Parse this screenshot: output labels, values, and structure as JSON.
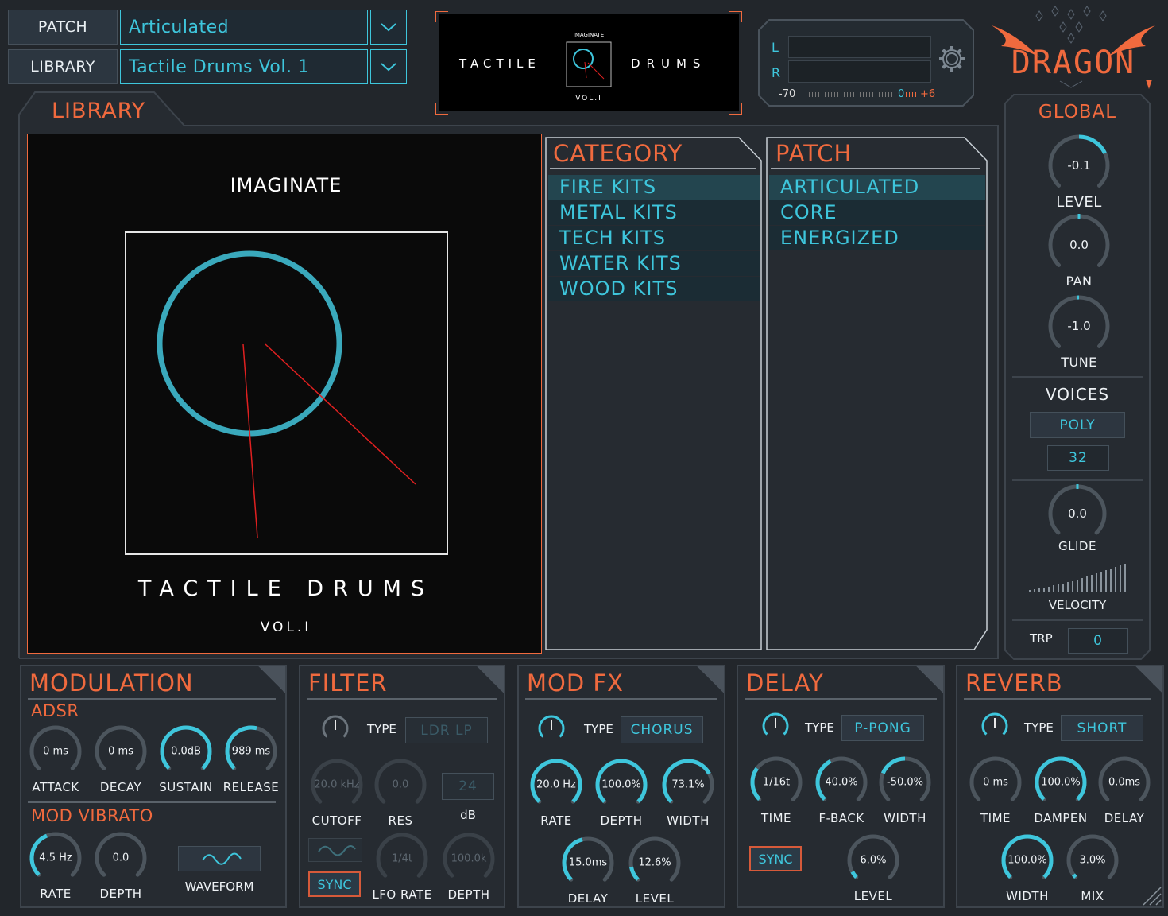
{
  "header": {
    "patch_label": "PATCH",
    "patch_value": "Articulated",
    "library_label": "LIBRARY",
    "library_value": "Tactile Drums Vol. 1",
    "artwork_brand": "IMAGINATE",
    "artwork_left": "TACTILE",
    "artwork_right": "DRUMS",
    "artwork_vol": "VOL.I"
  },
  "meter": {
    "l_label": "L",
    "r_label": "R",
    "min_label": "-70",
    "zero_label": "0",
    "max_label": "+6",
    "level_l": 0.0,
    "level_r": 0.0
  },
  "logo": {
    "text": "DRAGON"
  },
  "library": {
    "tab_label": "LIBRARY",
    "artwork_brand": "IMAGINATE",
    "artwork_title": "TACTILE DRUMS",
    "artwork_vol": "VOL.I",
    "category_header": "CATEGORY",
    "patch_header": "PATCH",
    "categories": [
      "FIRE KITS",
      "METAL KITS",
      "TECH KITS",
      "WATER KITS",
      "WOOD KITS"
    ],
    "patches": [
      "ARTICULATED",
      "CORE",
      "ENERGIZED"
    ]
  },
  "global": {
    "title": "GLOBAL",
    "level": {
      "label": "LEVEL",
      "value": "-0.1"
    },
    "pan": {
      "label": "PAN",
      "value": "0.0"
    },
    "tune": {
      "label": "TUNE",
      "value": "-1.0"
    },
    "voices_title": "VOICES",
    "voices_mode": "POLY",
    "voices_count": "32",
    "glide": {
      "label": "GLIDE",
      "value": "0.0"
    },
    "velocity_label": "VELOCITY",
    "trp_label": "TRP",
    "trp_value": "0"
  },
  "modulation": {
    "title": "MODULATION",
    "adsr_title": "ADSR",
    "attack": {
      "label": "ATTACK",
      "value": "0 ms"
    },
    "decay": {
      "label": "DECAY",
      "value": "0 ms"
    },
    "sustain": {
      "label": "SUSTAIN",
      "value": "0.0dB"
    },
    "release": {
      "label": "RELEASE",
      "value": "989 ms"
    },
    "vibrato_title": "MOD VIBRATO",
    "rate": {
      "label": "RATE",
      "value": "4.5 Hz"
    },
    "depth": {
      "label": "DEPTH",
      "value": "0.0"
    },
    "waveform_label": "WAVEFORM"
  },
  "filter": {
    "title": "FILTER",
    "type_label": "TYPE",
    "type_value": "LDR LP",
    "cutoff": {
      "label": "CUTOFF",
      "value": "20.0 kHz"
    },
    "res": {
      "label": "RES",
      "value": "0.0"
    },
    "db_value": "24",
    "db_label": "dB",
    "sync_label": "SYNC",
    "lfo_rate": {
      "label": "LFO RATE",
      "value": "1/4t"
    },
    "depth": {
      "label": "DEPTH",
      "value": "100.0k"
    }
  },
  "modfx": {
    "title": "MOD FX",
    "type_label": "TYPE",
    "type_value": "CHORUS",
    "rate": {
      "label": "RATE",
      "value": "20.0 Hz"
    },
    "depth": {
      "label": "DEPTH",
      "value": "100.0%"
    },
    "width": {
      "label": "WIDTH",
      "value": "73.1%"
    },
    "delay": {
      "label": "DELAY",
      "value": "15.0ms"
    },
    "level": {
      "label": "LEVEL",
      "value": "12.6%"
    }
  },
  "delay": {
    "title": "DELAY",
    "type_label": "TYPE",
    "type_value": "P-PONG",
    "time": {
      "label": "TIME",
      "value": "1/16t"
    },
    "fback": {
      "label": "F-BACK",
      "value": "40.0%"
    },
    "width": {
      "label": "WIDTH",
      "value": "-50.0%"
    },
    "sync_label": "SYNC",
    "level": {
      "label": "LEVEL",
      "value": "6.0%"
    }
  },
  "reverb": {
    "title": "REVERB",
    "type_label": "TYPE",
    "type_value": "SHORT",
    "time": {
      "label": "TIME",
      "value": "0 ms"
    },
    "dampen": {
      "label": "DAMPEN",
      "value": "100.0%"
    },
    "delay": {
      "label": "DELAY",
      "value": "0.0ms"
    },
    "width": {
      "label": "WIDTH",
      "value": "100.0%"
    },
    "mix": {
      "label": "MIX",
      "value": "3.0%"
    }
  },
  "colors": {
    "accent": "#3ec6dc",
    "title": "#f06a3e",
    "bg": "#22262b"
  }
}
